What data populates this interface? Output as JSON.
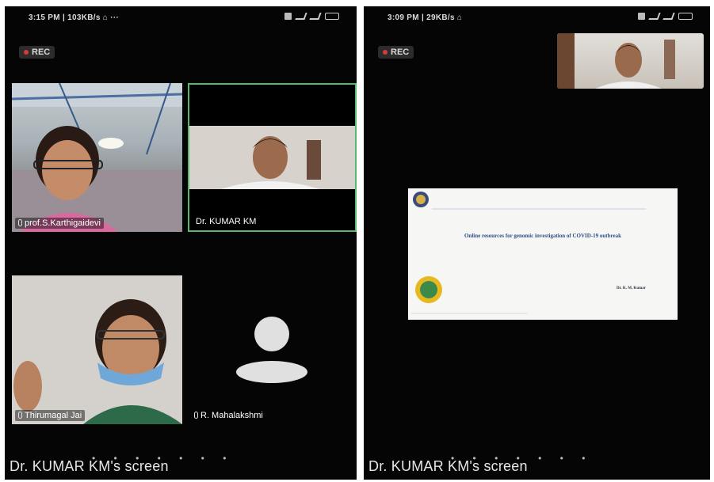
{
  "left_screen": {
    "status_time": "3:15 PM | 103KB/s ⌂  ···",
    "rec_label": "REC",
    "participants": [
      {
        "name": "prof.S.Karthigaidevi"
      },
      {
        "name": "Dr. KUMAR KM"
      },
      {
        "name": "Thirumagal Jai"
      },
      {
        "name": "R. Mahalakshmi"
      }
    ],
    "screen_caption": "Dr. KUMAR KM's screen"
  },
  "right_screen": {
    "status_time": "3:09 PM | 29KB/s ⌂",
    "rec_label": "REC",
    "slide": {
      "title": "Online resources for genomic investigation of COVID-19 outbreak",
      "author": "Dr. K. M. Kumar"
    },
    "screen_caption": "Dr. KUMAR KM's screen"
  },
  "colors": {
    "active_speaker_border": "#58b86c",
    "rec_dot": "#d83a3a",
    "background": "#050505"
  },
  "icons": {
    "mic": "mic-icon",
    "avatar": "person-avatar-icon"
  }
}
